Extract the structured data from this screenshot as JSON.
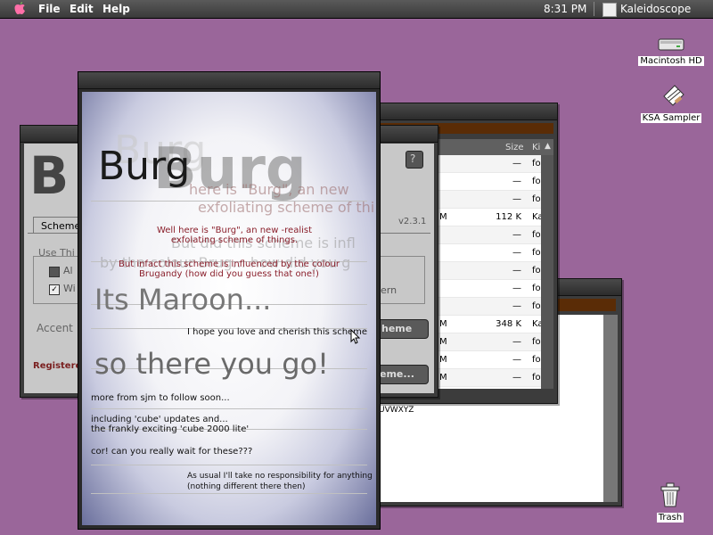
{
  "menubar": {
    "menus": [
      "File",
      "Edit",
      "Help"
    ],
    "clock": "8:31 PM",
    "app_name": "Kaleidoscope"
  },
  "desktop": {
    "icons": [
      {
        "label": "Macintosh HD",
        "icon": "hard-disk-icon"
      },
      {
        "label": "KSA Sampler",
        "icon": "document-icon"
      },
      {
        "label": "Trash",
        "icon": "trash-icon"
      }
    ]
  },
  "file_window": {
    "col_size": "Size",
    "col_kind": "Ki",
    "rows": [
      {
        "name": "",
        "size": "—",
        "kind": "fol"
      },
      {
        "name": "",
        "size": "—",
        "kind": "fol"
      },
      {
        "name": "",
        "size": "—",
        "kind": "fol"
      },
      {
        "name": "M",
        "size": "112 K",
        "kind": "Ka"
      },
      {
        "name": "",
        "size": "—",
        "kind": "fol"
      },
      {
        "name": "",
        "size": "—",
        "kind": "fol"
      },
      {
        "name": "",
        "size": "—",
        "kind": "fol"
      },
      {
        "name": "",
        "size": "—",
        "kind": "fol"
      },
      {
        "name": "",
        "size": "—",
        "kind": "fol"
      },
      {
        "name": "M",
        "size": "348 K",
        "kind": "Ka"
      },
      {
        "name": "M",
        "size": "—",
        "kind": "fol"
      },
      {
        "name": "M",
        "size": "—",
        "kind": "fol"
      },
      {
        "name": "M",
        "size": "—",
        "kind": "fol"
      }
    ]
  },
  "white_window": {
    "alphabet": "UVWXYZ"
  },
  "kaleidoscope_panel": {
    "title_letter": "B",
    "version": "v2.3.1",
    "tab_label": "Scheme",
    "use_label": "Use Thi",
    "check1": "Al",
    "check2": "Wi",
    "right_label": "ern",
    "accent_label": "Accent",
    "scheme_btn": "heme",
    "scheme_btn2": "eme...",
    "registered": "Registere"
  },
  "splash": {
    "title": "Burg",
    "ghost_title": "Burg",
    "line1": "Well here is \"Burg\", an new -realist exfolating scheme of things.",
    "ghost1": "here is \"Burg\", an new",
    "ghost2": "exfoliating scheme of thi",
    "ghost3": "But did this scheme is infl",
    "ghost4": "by the colour Brug... how did you g",
    "line2": "But infact this scheme is influenced by the colour Brugandy (how did you guess that one!)",
    "maroon": "Its Maroon...",
    "love": "I hope you love and cherish this scheme",
    "there": "so there you go!",
    "more": "more from sjm to follow soon...",
    "cube": "including 'cube' updates and...",
    "cube2": "the frankly exciting 'cube 2000 lite'",
    "cor": "cor! can you really wait for these???",
    "disclaimer1": "As usual I'll take no responsibility for anything",
    "disclaimer2": "(nothing different there then)"
  }
}
